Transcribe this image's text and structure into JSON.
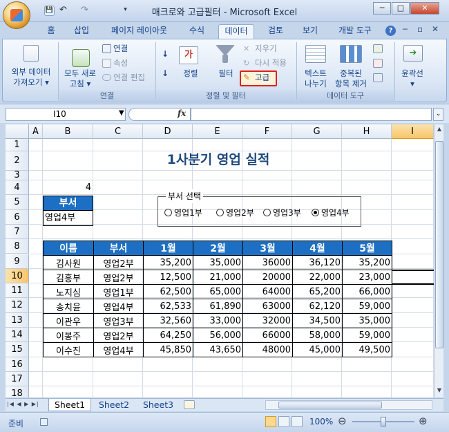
{
  "window": {
    "title": "매크로와 고급필터 - Microsoft Excel",
    "controls": {
      "minimize": "─",
      "maximize": "□",
      "close": "✕"
    }
  },
  "qat": {
    "save": "💾",
    "undo": "↶",
    "redo": "↷",
    "dropdown": "▾"
  },
  "tabs": [
    "홈",
    "삽입",
    "페이지 레이아웃",
    "수식",
    "데이터",
    "검토",
    "보기",
    "개발 도구"
  ],
  "active_tab": "데이터",
  "ribbon_controls": {
    "help": "?",
    "min": "─",
    "restore": "▫",
    "close": "✕"
  },
  "ribbon": {
    "external_data": "외부 데이터\n가져오기 ▾",
    "refresh_all_line1": "모두 새로",
    "refresh_all_line2": "고침 ▾",
    "connections": "연결",
    "properties": "속성",
    "edit_links": "연결 편집",
    "group_connections": "연결",
    "sort": "정렬",
    "filter": "필터",
    "clear": "지우기",
    "reapply": "다시 적용",
    "advanced": "고급",
    "group_sort_filter": "정렬 및 필터",
    "text_to_columns_line1": "텍스트",
    "text_to_columns_line2": "나누기",
    "remove_duplicates_line1": "중복된",
    "remove_duplicates_line2": "항목 제거",
    "group_data_tools": "데이터 도구",
    "outline": "윤곽선",
    "outline_arrow": "▾"
  },
  "formula_bar": {
    "name_box": "I10",
    "fx": "fx",
    "value": ""
  },
  "columns": [
    "A",
    "B",
    "C",
    "D",
    "E",
    "F",
    "G",
    "H",
    "I"
  ],
  "rows": [
    "1",
    "2",
    "3",
    "4",
    "5",
    "6",
    "7",
    "8",
    "9",
    "10",
    "11",
    "12",
    "13",
    "14",
    "15",
    "16",
    "17",
    "18"
  ],
  "selected_column": "I",
  "selected_row": "10",
  "sheet": {
    "title": "1사분기 영업 실적",
    "b4_value": "4",
    "dept_header": "부서",
    "dept_value": "영업4부",
    "group_label": "부서 선택",
    "radios": [
      "영업1부",
      "영업2부",
      "영업3부",
      "영업4부"
    ],
    "radio_selected": 3,
    "table_headers": [
      "이름",
      "부서",
      "1월",
      "2월",
      "3월",
      "4월",
      "5월"
    ],
    "table_rows": [
      [
        "김사원",
        "영업2부",
        "35,200",
        "35,000",
        "36000",
        "36,120",
        "35,200"
      ],
      [
        "김흥부",
        "영업2부",
        "12,500",
        "21,000",
        "20000",
        "22,000",
        "23,000"
      ],
      [
        "노지심",
        "영업1부",
        "62,500",
        "65,000",
        "64000",
        "65,200",
        "66,000"
      ],
      [
        "송치윤",
        "영업4부",
        "62,533",
        "61,890",
        "63000",
        "62,120",
        "59,000"
      ],
      [
        "이관우",
        "영업3부",
        "32,560",
        "33,000",
        "32000",
        "34,500",
        "35,000"
      ],
      [
        "이봉주",
        "영업2부",
        "64,250",
        "56,000",
        "66000",
        "58,000",
        "59,000"
      ],
      [
        "이수진",
        "영업4부",
        "45,850",
        "43,650",
        "48000",
        "45,000",
        "49,500"
      ]
    ]
  },
  "sheet_tabs": [
    "Sheet1",
    "Sheet2",
    "Sheet3"
  ],
  "active_sheet": "Sheet1",
  "status": {
    "ready": "준비",
    "zoom": "100%",
    "zoom_out": "⊖",
    "zoom_in": "⊕"
  },
  "colors": {
    "header_blue": "#1c6fc2",
    "title_blue": "#1f497d",
    "highlight_red": "#e0201b"
  }
}
